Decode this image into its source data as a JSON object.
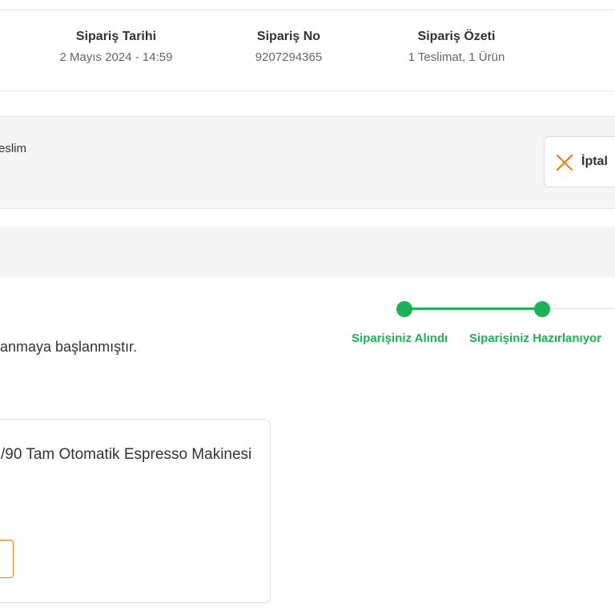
{
  "order_summary": {
    "date_title": "Sipariş Tarihi",
    "date_value": "2 Mayıs 2024 - 14:59",
    "number_title": "Sipariş No",
    "number_value": "9207294365",
    "summary_title": "Sipariş Özeti",
    "summary_value": "1 Teslimat, 1 Ürün"
  },
  "delivery": {
    "label": "eslim",
    "cancel_label": "İptal"
  },
  "tracker": {
    "steps": [
      {
        "label": "Siparişiniz Alındı",
        "status": "done"
      },
      {
        "label": "Siparişiniz Hazırlanıyor",
        "status": "done"
      }
    ]
  },
  "status_message": "anmaya başlanmıştır.",
  "product": {
    "name": "/90 Tam Otomatik Espresso Makinesi"
  },
  "colors": {
    "accent_green": "#1bb355",
    "accent_orange": "#f27a1a"
  }
}
